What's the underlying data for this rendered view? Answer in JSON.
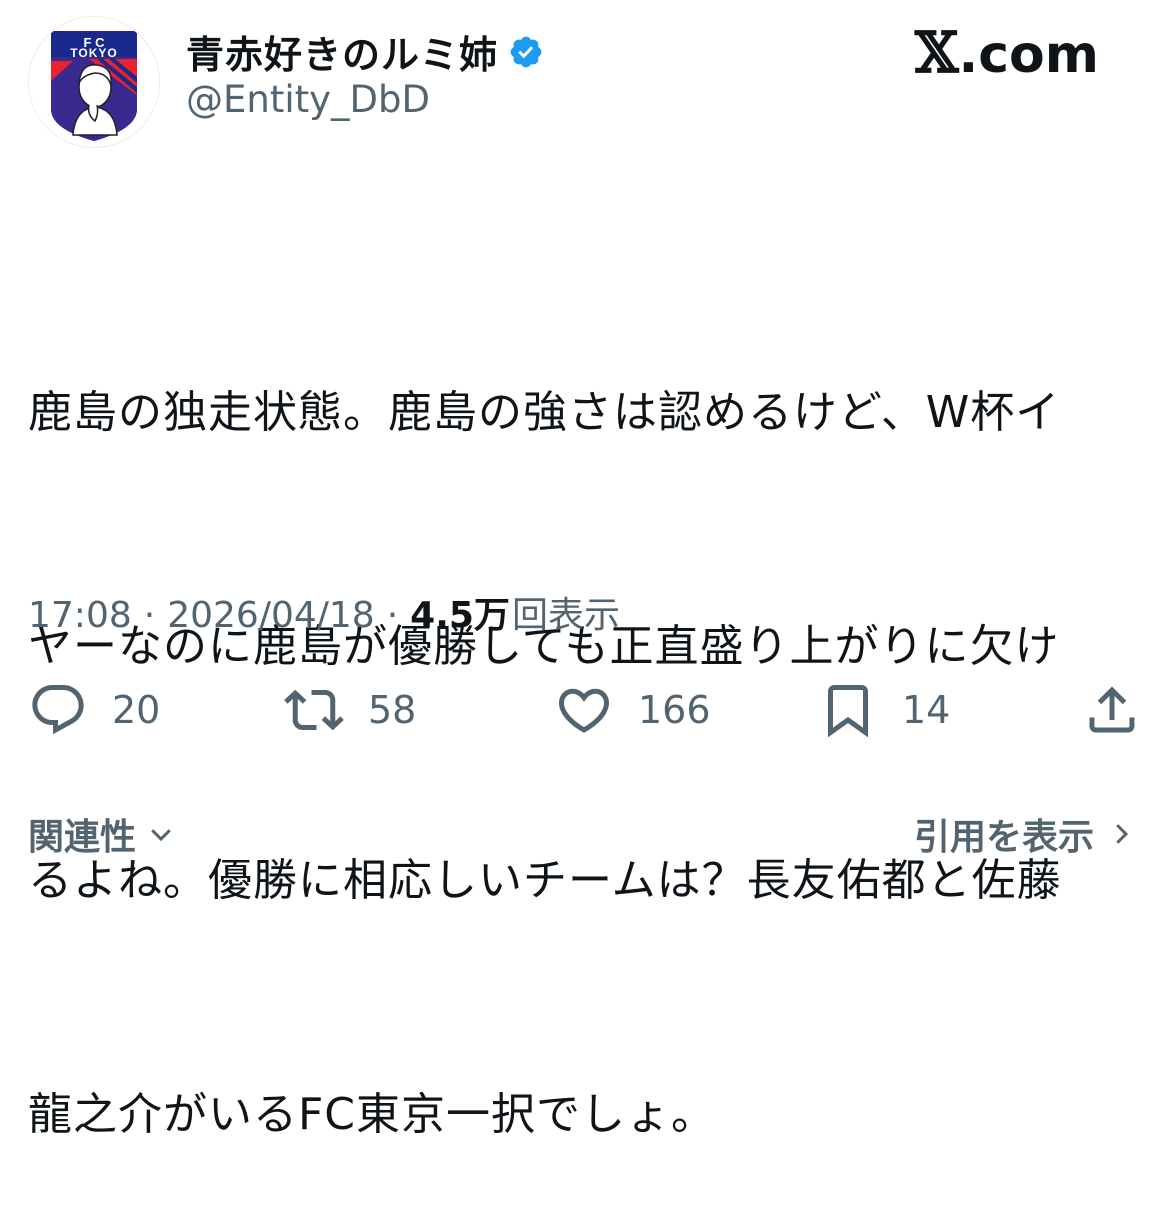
{
  "header": {
    "display_name": "青赤好きのルミ姉",
    "handle": "@Entity_DbD",
    "verified": true,
    "brand_x": "𝕏",
    "brand_suffix": ".com",
    "avatar_text_top": "F    C",
    "avatar_text_mid": "TOKYO"
  },
  "tweet": {
    "lines": [
      "鹿島の独走状態。鹿島の強さは認めるけど、W杯イ",
      "ヤーなのに鹿島が優勝しても正直盛り上がりに欠け",
      "るよね。優勝に相応しいチームは？長友佑都と佐藤",
      "龍之介がいるFC東京一択でしょ。"
    ],
    "time": "17:08",
    "separator": "·",
    "date": "2026/04/18",
    "views_count": "4.5万",
    "views_label": "回表示"
  },
  "actions": {
    "reply_count": "20",
    "retweet_count": "58",
    "like_count": "166",
    "bookmark_count": "14"
  },
  "footer": {
    "related_label": "関連性",
    "quotes_label": "引用を表示"
  },
  "colors": {
    "text_primary": "#0f1419",
    "text_secondary": "#536471",
    "verified_blue": "#1d9bf0",
    "fc_tokyo_blue": "#1a2a8c",
    "fc_tokyo_red": "#e8232e"
  },
  "icons": [
    "verified-badge-icon",
    "reply-icon",
    "retweet-icon",
    "like-icon",
    "bookmark-icon",
    "share-icon",
    "chevron-down-icon",
    "chevron-right-icon"
  ]
}
